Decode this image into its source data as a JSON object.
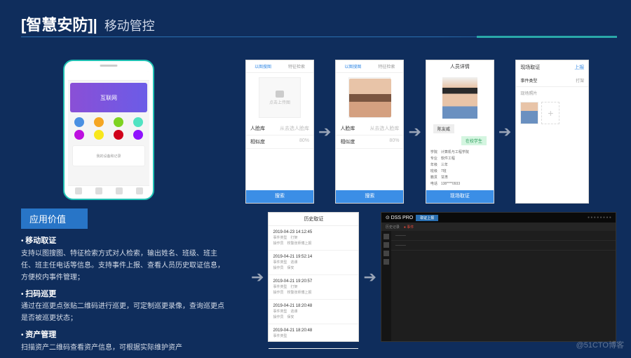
{
  "header": {
    "title": "[智慧安防]|",
    "subtitle": "移动管控"
  },
  "phone": {
    "banner": "互联网",
    "card": "我的设备和记录"
  },
  "value": {
    "header": "应用价值",
    "sections": [
      {
        "title": "移动取证",
        "desc": "支持以图搜图、特征检索方式对人检索，输出姓名、班级、班主任、班主任电话等信息。支持事件上报、查看人员历史取证信息，方便校内事件管理；"
      },
      {
        "title": "扫码巡更",
        "desc": "通过在巡更点张贴二维码进行巡更，可定制巡更录像，查询巡更点是否被巡更状态；"
      },
      {
        "title": "资产管理",
        "desc": "扫描资产二维码查看资产信息，可根据实际维护资产"
      }
    ]
  },
  "search": {
    "tab1": "以图搜图",
    "tab2": "特征检索",
    "upload": "点击上传图",
    "field1_label": "人脸库",
    "field1_val": "从去选人脸库",
    "field2_label": "相似度",
    "field2_val": "80%",
    "btn": "搜索"
  },
  "detail": {
    "title": "人员详情",
    "tag1": "陈友威",
    "tag2": "在校学生",
    "info": {
      "学院": "计算机与工程学院",
      "专业": "软件工程",
      "年级": "三年",
      "班级": "7班",
      "籍贯": "甘肃",
      "电话": "138****0933"
    },
    "btn": "现场取证"
  },
  "evidence": {
    "left": "现场取证",
    "right": "上报",
    "row1_l": "事件类型",
    "row1_r": "打架",
    "sec": "现场照片"
  },
  "history": {
    "title": "历史取证",
    "items": [
      {
        "dt": "2019-04-23 14:12:45",
        "a": "事件类型",
        "av": "打架",
        "b": "操作员",
        "bv": "校警张师傅上报"
      },
      {
        "dt": "2019-04-21 19:52:14",
        "a": "事件类型",
        "av": "逃课",
        "b": "操作员",
        "bv": "保安"
      },
      {
        "dt": "2019-04-21 19:20:57",
        "a": "事件类型",
        "av": "打架",
        "b": "操作员",
        "bv": "校警张师傅上报"
      },
      {
        "dt": "2019-04-21 18:20:48",
        "a": "事件类型",
        "av": "逃课",
        "b": "操作员",
        "bv": "保安"
      },
      {
        "dt": "2019-04-21 18:20:48",
        "a": "事件类型",
        "av": "",
        "b": "",
        "bv": ""
      }
    ]
  },
  "dss": {
    "logo": "⊙ DSS PRO",
    "tab": "取证上报",
    "tb1": "历史记录",
    "tb2": "● 事件"
  },
  "watermark": "@51CTO博客"
}
